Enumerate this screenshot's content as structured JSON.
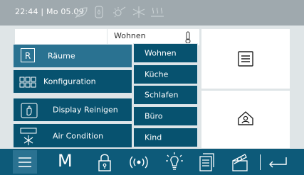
{
  "status_bar": {
    "clock": "22:44 | Mo 05.09",
    "icons": [
      "leaf-icon",
      "water-drop-icon",
      "sun-icon",
      "snowflake-icon",
      "heating-icon"
    ]
  },
  "room_tile": {
    "label": "Wohnen",
    "icon": "thermometer-icon"
  },
  "main_menu": {
    "items": [
      {
        "label": "Räume",
        "icon": "room-letter-icon",
        "icon_text": "R",
        "active": true
      },
      {
        "label": "Konfiguration",
        "icon": "grid-icon",
        "active": false
      },
      {
        "label": "Display Reinigen",
        "icon": "hand-cleaning-icon",
        "active": false
      },
      {
        "label": "Air Condition",
        "icon": "air-condition-icon",
        "active": false
      }
    ]
  },
  "submenu": {
    "items": [
      "Wohnen",
      "Küche",
      "Schlafen",
      "Büro",
      "Kind"
    ]
  },
  "tiles": {
    "right_top_icon": "notes-icon",
    "right_bottom_icon": "home-person-icon"
  },
  "bottom_bar": {
    "items": [
      {
        "icon": "menu-icon"
      },
      {
        "icon": "manual-m-icon",
        "label": "M"
      },
      {
        "icon": "lock-icon"
      },
      {
        "icon": "wireless-icon"
      },
      {
        "icon": "light-bulb-icon"
      },
      {
        "icon": "documents-icon"
      },
      {
        "icon": "clapperboard-icon"
      },
      {
        "icon": "return-icon"
      }
    ]
  },
  "colors": {
    "status_bar_bg": "#9fa9ae",
    "menu_bg": "#07526f",
    "menu_active_bg": "#2a7291",
    "bottom_bar_bg": "#0d5a79",
    "background": "#dfe5e7"
  }
}
